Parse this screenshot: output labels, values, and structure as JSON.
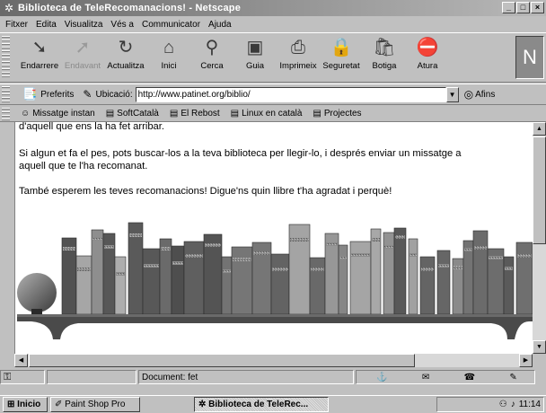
{
  "window": {
    "title": "Biblioteca de TeleRecomanacions! - Netscape",
    "controls": [
      "_",
      "□",
      "×"
    ]
  },
  "menu": [
    "Fitxer",
    "Edita",
    "Visualitza",
    "Vés a",
    "Communicator",
    "Ajuda"
  ],
  "toolbar": {
    "buttons": [
      {
        "label": "Endarrere",
        "icon": "back-arrow-icon",
        "glyph": "➘",
        "disabled": false
      },
      {
        "label": "Endavant",
        "icon": "forward-arrow-icon",
        "glyph": "➚",
        "disabled": true
      },
      {
        "label": "Actualitza",
        "icon": "reload-icon",
        "glyph": "↻",
        "disabled": false
      },
      {
        "label": "Inici",
        "icon": "home-icon",
        "glyph": "⌂",
        "disabled": false
      },
      {
        "label": "Cerca",
        "icon": "search-icon",
        "glyph": "⚲",
        "disabled": false
      },
      {
        "label": "Guia",
        "icon": "guide-icon",
        "glyph": "▣",
        "disabled": false
      },
      {
        "label": "Imprimeix",
        "icon": "print-icon",
        "glyph": "⎙",
        "disabled": false
      },
      {
        "label": "Seguretat",
        "icon": "lock-icon",
        "glyph": "🔒",
        "disabled": false
      },
      {
        "label": "Botiga",
        "icon": "shop-icon",
        "glyph": "🛍",
        "disabled": false
      },
      {
        "label": "Atura",
        "icon": "stop-icon",
        "glyph": "⛔",
        "disabled": false
      }
    ]
  },
  "location": {
    "bookmarks_label": "Preferits",
    "location_label": "Ubicació:",
    "url": "http://www.patinet.org/biblio/",
    "related_label": "Afins"
  },
  "personal_toolbar": [
    "Missatge instan",
    "SoftCatalà",
    "El Rebost",
    "Linux en català",
    "Projectes"
  ],
  "content": {
    "para1": "d'aquell que ens la ha fet arribar.",
    "para2_line1": "Si algun et fa el pes, pots buscar-los a la teva biblioteca per llegir-lo, i després enviar un missatge a",
    "para2_line2": "aquell que te l'ha recomanat.",
    "para3": "També esperem les teves recomanacions! Digue'ns quin llibre t'ha agradat i perquè!"
  },
  "status": {
    "text": "Document: fet"
  },
  "taskbar": {
    "start": "Inicio",
    "tasks": [
      "Paint Shop Pro",
      "Biblioteca de TeleRec..."
    ],
    "clock": "11:14"
  }
}
